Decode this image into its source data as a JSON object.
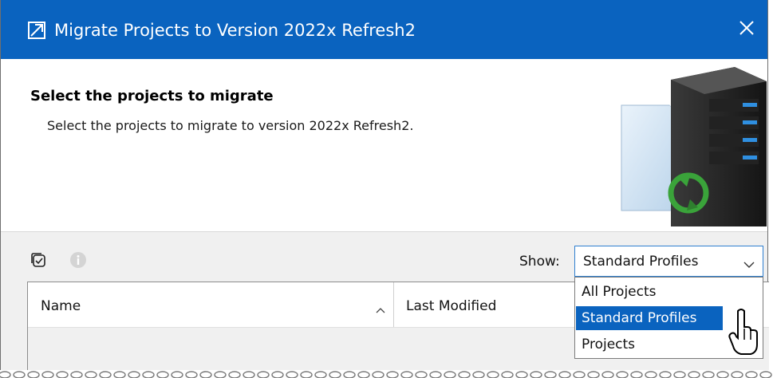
{
  "window": {
    "title": "Migrate Projects to Version 2022x Refresh2",
    "close_glyph": "✕"
  },
  "header": {
    "title": "Select the projects to migrate",
    "description": "Select the projects to migrate to version 2022x Refresh2."
  },
  "toolbar": {
    "show_label": "Show:",
    "show_selected": "Standard Profiles"
  },
  "table": {
    "columns": [
      "Name",
      "Last Modified"
    ]
  },
  "dropdown": {
    "options": [
      "All Projects",
      "Standard Profiles",
      "Projects"
    ],
    "highlighted": "Standard Profiles"
  },
  "colors": {
    "titlebar": "#0a63bf",
    "accent": "#0a63bf"
  },
  "icons": {
    "app": "migrate-window-icon",
    "close": "close-icon",
    "select_all": "select-checklist-icon",
    "info": "info-icon",
    "dropdown_arrow": "chevron-down-icon",
    "sort": "sort-ascending-icon",
    "cursor": "pointer-cursor-icon"
  }
}
